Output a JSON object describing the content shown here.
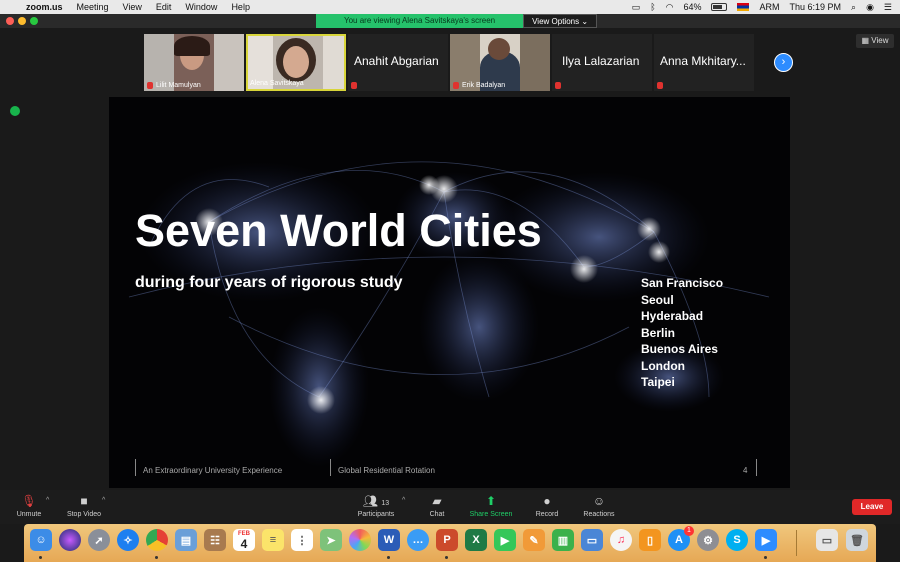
{
  "menubar": {
    "app_name": "zoom.us",
    "menus": [
      "Meeting",
      "View",
      "Edit",
      "Window",
      "Help"
    ],
    "battery": "64%",
    "input_source": "ARM",
    "clock": "Thu 6:19 PM"
  },
  "share_banner": {
    "message": "You are viewing Alena Savitskaya's screen",
    "options_label": "View Options"
  },
  "gallery": {
    "participants": [
      {
        "name": "Lilit Mamulyan",
        "has_video": true
      },
      {
        "name": "Alena Savitskaya",
        "has_video": true,
        "active_speaker": true
      },
      {
        "name": "Anahit Abgarian",
        "has_video": false
      },
      {
        "name": "Erik Badalyan",
        "has_video": true
      },
      {
        "name": "Ilya Lalazarian",
        "has_video": false
      },
      {
        "name": "Anna Mkhitary...",
        "has_video": false
      }
    ],
    "view_label": "View"
  },
  "slide": {
    "title": "Seven World Cities",
    "subtitle": "during four years of rigorous study",
    "cities": [
      "San Francisco",
      "Seoul",
      "Hyderabad",
      "Berlin",
      "Buenos Aires",
      "London",
      "Taipei"
    ],
    "footer_left": "An Extraordinary University Experience",
    "footer_middle": "Global Residential Rotation",
    "page_number": "4"
  },
  "toolbar": {
    "unmute": "Unmute",
    "stop_video": "Stop Video",
    "participants": "Participants",
    "participants_count": "13",
    "chat": "Chat",
    "share_screen": "Share Screen",
    "record": "Record",
    "reactions": "Reactions",
    "leave": "Leave"
  },
  "dock": {
    "calendar_month": "FEB",
    "calendar_day": "4",
    "appstore_badge": "1",
    "apps": [
      "Finder",
      "Siri",
      "Launchpad",
      "Safari",
      "Chrome",
      "Preview",
      "Contacts",
      "Calendar",
      "Notes",
      "Reminders",
      "Maps",
      "Photos",
      "Word",
      "Messages",
      "PowerPoint",
      "Excel",
      "FaceTime",
      "Pages",
      "Numbers",
      "Keynote",
      "Music",
      "Books",
      "App Store",
      "System Preferences",
      "Skype",
      "Zoom",
      "Preview Docs",
      "Trash"
    ]
  }
}
